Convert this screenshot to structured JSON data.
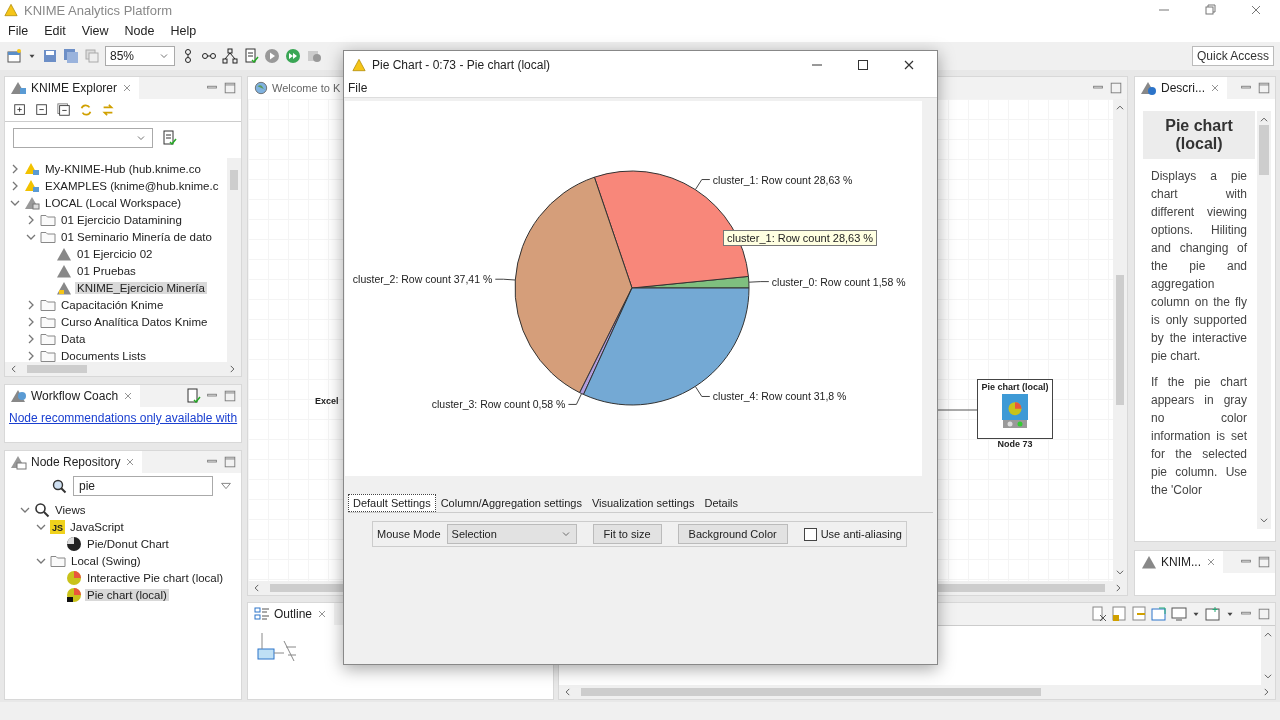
{
  "app": {
    "title": "KNIME Analytics Platform"
  },
  "menu": [
    "File",
    "Edit",
    "View",
    "Node",
    "Help"
  ],
  "toolbar": {
    "zoom": "85%",
    "quick_access": "Quick Access"
  },
  "explorer": {
    "title": "KNIME Explorer",
    "tree": [
      {
        "label": "My-KNIME-Hub (hub.knime.co",
        "kind": "hub",
        "expanded": false,
        "selected": false
      },
      {
        "label": "EXAMPLES (knime@hub.knime.c",
        "kind": "hub",
        "expanded": false,
        "selected": false
      },
      {
        "label": "LOCAL (Local Workspace)",
        "kind": "mountpoint",
        "expanded": true,
        "selected": false,
        "children": [
          {
            "label": "01 Ejercicio Datamining",
            "kind": "folder",
            "expanded": false,
            "selected": false
          },
          {
            "label": "01 Seminario Minería de dato",
            "kind": "folder",
            "expanded": true,
            "selected": false,
            "children": [
              {
                "label": "01 Ejercicio 02",
                "kind": "workflow",
                "selected": false
              },
              {
                "label": "01 Pruebas",
                "kind": "workflow",
                "selected": false
              },
              {
                "label": "KNIME_Ejercicio Minería",
                "kind": "workflow",
                "selected": true
              }
            ]
          },
          {
            "label": "Capacitación Knime",
            "kind": "folder",
            "expanded": false,
            "selected": false
          },
          {
            "label": "Curso Analítica Datos Knime",
            "kind": "folder",
            "expanded": false,
            "selected": false
          },
          {
            "label": "Data",
            "kind": "folder",
            "expanded": false,
            "selected": false
          },
          {
            "label": "Documents Lists",
            "kind": "folder",
            "expanded": false,
            "selected": false
          }
        ]
      }
    ]
  },
  "workflow_coach": {
    "title": "Workflow Coach",
    "link": "Node recommendations only available with"
  },
  "node_repository": {
    "title": "Node Repository",
    "search": "pie",
    "tree": [
      {
        "label": "Views",
        "kind": "category",
        "expanded": true,
        "selected": false,
        "children": [
          {
            "label": "JavaScript",
            "kind": "js",
            "icon_text": "JS",
            "expanded": true,
            "selected": false,
            "children": [
              {
                "label": "Pie/Donut Chart",
                "kind": "donut-node",
                "selected": false
              }
            ]
          },
          {
            "label": "Local (Swing)",
            "kind": "folder",
            "expanded": true,
            "selected": false,
            "children": [
              {
                "label": "Interactive Pie chart (local)",
                "kind": "pie-node",
                "selected": false
              },
              {
                "label": "Pie chart (local)",
                "kind": "pie-node",
                "selected": true
              }
            ]
          }
        ]
      }
    ]
  },
  "editor": {
    "tab": "Welcome to K",
    "canvas_label": "Excel",
    "node": {
      "title": "Pie chart (local)",
      "caption": "Node 73"
    }
  },
  "outline": {
    "title": "Outline"
  },
  "description": {
    "title": "Descri...",
    "heading": "Pie chart (local)",
    "paragraphs": [
      "Displays a pie chart with different viewing options. Hiliting and changing of the pie and aggregation column on the fly is only supported by the interactive pie chart.",
      "If the pie chart appears in gray no color information is set for the selected pie column. Use the 'Color"
    ]
  },
  "knime_panel": {
    "title": "KNIM..."
  },
  "dialog": {
    "title": "Pie Chart - 0:73 - Pie chart (local)",
    "menu": [
      "File"
    ],
    "chart_data": {
      "type": "pie",
      "values": [
        1.58,
        28.63,
        37.41,
        0.58,
        31.8
      ],
      "colors": [
        "#7fbf7f",
        "#f8877a",
        "#d59e7a",
        "#b39ddb",
        "#74a9d4"
      ],
      "value_labels": [
        "cluster_0: Row count 1,58 %",
        "cluster_1: Row count 28,63 %",
        "cluster_2: Row count 37,41 %",
        "cluster_3: Row count 0,58 %",
        "cluster_4: Row count 31,8 %"
      ]
    },
    "tooltip": "cluster_1: Row count 28,63 %",
    "tabs": [
      {
        "label": "Default Settings",
        "selected": true
      },
      {
        "label": "Column/Aggregation settings",
        "selected": false
      },
      {
        "label": "Visualization settings",
        "selected": false
      },
      {
        "label": "Details",
        "selected": false
      }
    ],
    "mouse_mode": {
      "label": "Mouse Mode",
      "value": "Selection"
    },
    "buttons": [
      "Fit to size",
      "Background Color"
    ],
    "antialias": {
      "label": "Use anti-aliasing",
      "checked": false
    }
  }
}
